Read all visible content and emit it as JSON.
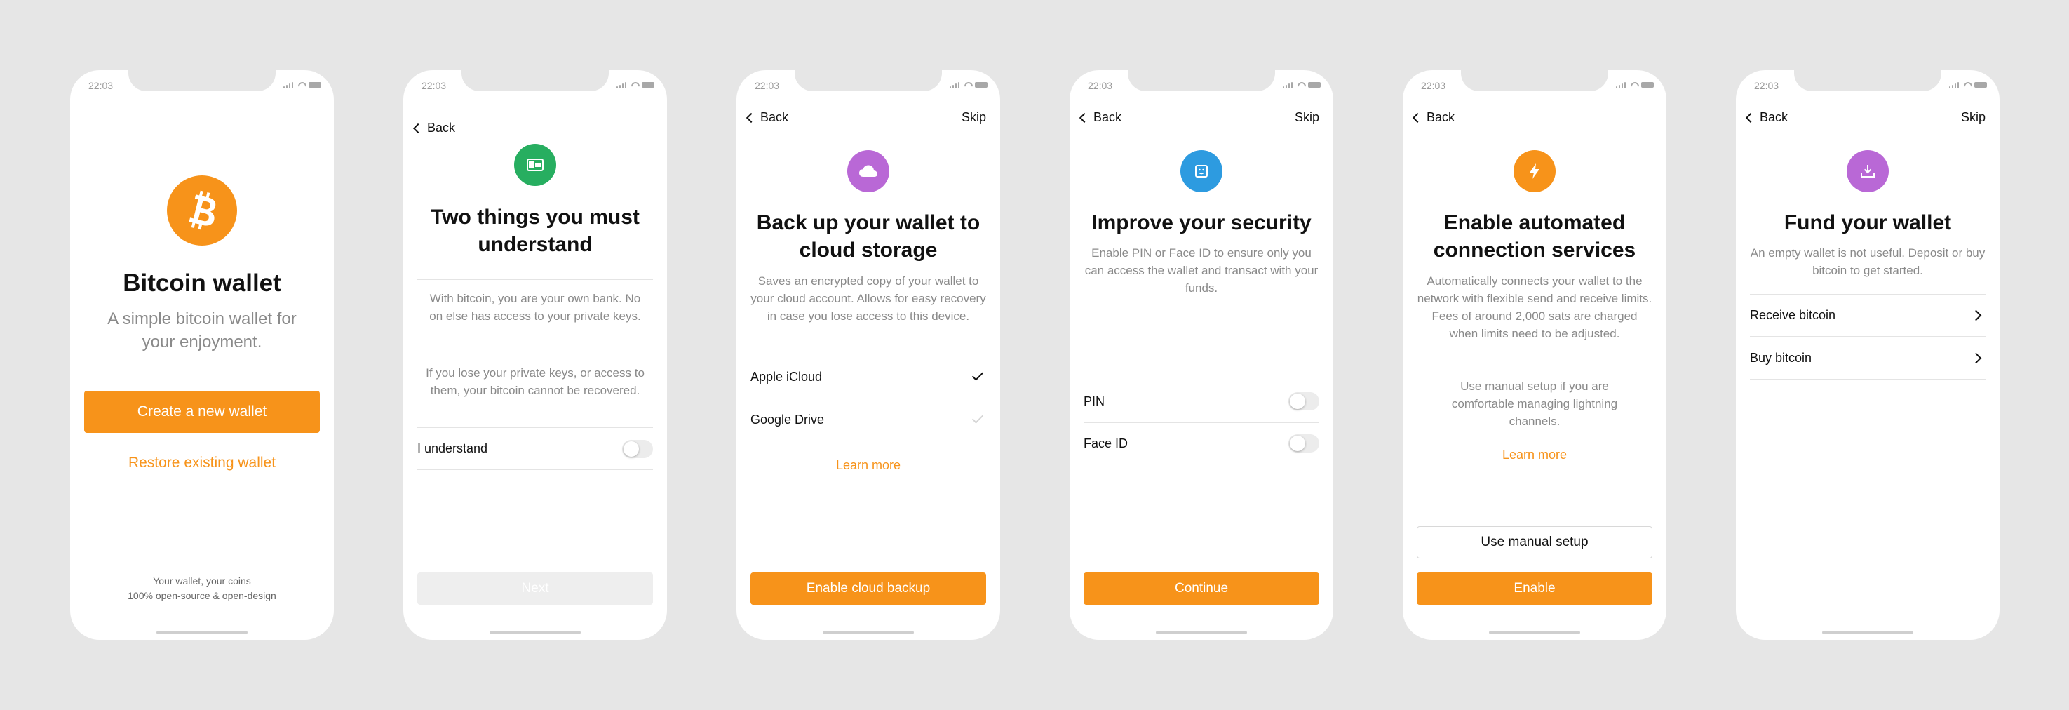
{
  "status_time": "22:03",
  "screens": {
    "welcome": {
      "title": "Bitcoin wallet",
      "subtitle": "A simple bitcoin wallet for your enjoyment.",
      "create_label": "Create a new wallet",
      "restore_label": "Restore existing wallet",
      "footer_line1": "Your wallet, your coins",
      "footer_line2": "100% open-source & open-design"
    },
    "understand": {
      "back_label": "Back",
      "title": "Two things you must understand",
      "para1": "With bitcoin, you are your own bank. No on else has access to your private keys.",
      "para2": "If you lose your private keys, or access to them, your bitcoin cannot be recovered.",
      "toggle_label": "I understand",
      "next_label": "Next"
    },
    "backup": {
      "back_label": "Back",
      "skip_label": "Skip",
      "title": "Back up your wallet to cloud storage",
      "desc": "Saves an encrypted copy of your wallet to your cloud account. Allows for easy recovery in case you lose access to this device.",
      "options": [
        "Apple iCloud",
        "Google Drive"
      ],
      "learn_more": "Learn more",
      "button_label": "Enable cloud backup"
    },
    "security": {
      "back_label": "Back",
      "skip_label": "Skip",
      "title": "Improve your security",
      "desc": "Enable PIN or Face ID to ensure only you can access the wallet and transact with your funds.",
      "options": [
        "PIN",
        "Face ID"
      ],
      "button_label": "Continue"
    },
    "connection": {
      "back_label": "Back",
      "title": "Enable automated connection services",
      "desc1": "Automatically connects your wallet to the network with flexible send and receive limits. Fees of around 2,000 sats are charged when limits need to be adjusted.",
      "desc2": "Use manual setup if you are comfortable managing lightning channels.",
      "learn_more": "Learn more",
      "manual_label": "Use manual setup",
      "enable_label": "Enable"
    },
    "fund": {
      "back_label": "Back",
      "skip_label": "Skip",
      "title": "Fund your wallet",
      "desc": "An empty wallet is not useful. Deposit or buy bitcoin to get started.",
      "options": [
        "Receive bitcoin",
        "Buy bitcoin"
      ]
    }
  },
  "colors": {
    "accent": "#f7931a",
    "understand_icon": "#27ae60",
    "backup_icon": "#b968d6",
    "security_icon": "#2d9be0",
    "connection_icon": "#f7931a",
    "fund_icon": "#b968d6"
  }
}
